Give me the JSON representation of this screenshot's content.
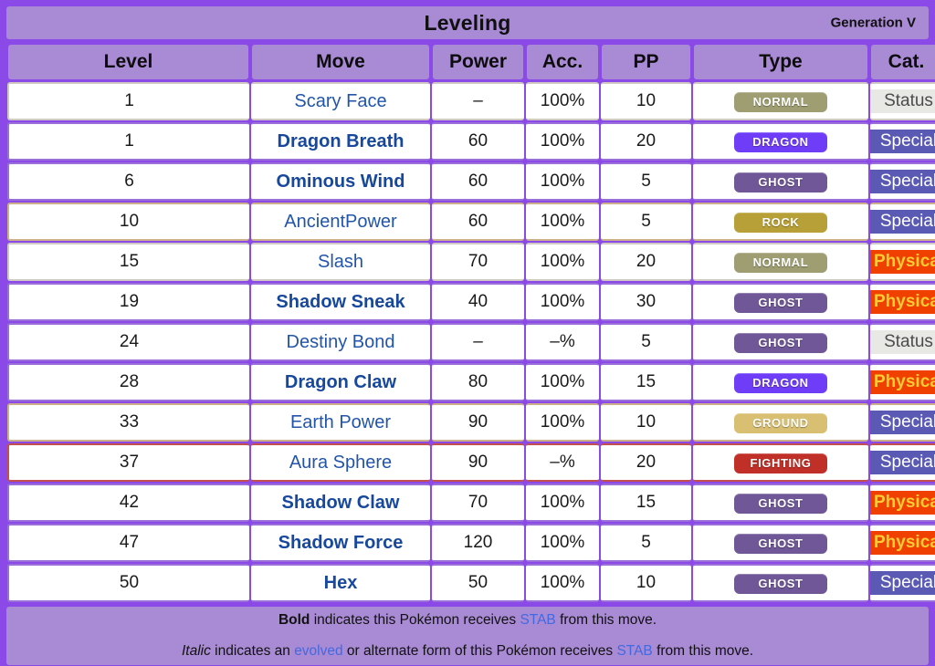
{
  "header": {
    "title": "Leveling",
    "generation": "Generation V"
  },
  "columns": [
    {
      "key": "level",
      "label": "Level"
    },
    {
      "key": "move",
      "label": "Move"
    },
    {
      "key": "power",
      "label": "Power"
    },
    {
      "key": "acc",
      "label": "Acc."
    },
    {
      "key": "pp",
      "label": "PP"
    },
    {
      "key": "type",
      "label": "Type"
    },
    {
      "key": "cat",
      "label": "Cat."
    }
  ],
  "type_colors": {
    "NORMAL": "#9e9e72",
    "DRAGON": "#6f3df7",
    "GHOST": "#705898",
    "ROCK": "#b8a038",
    "GROUND": "#d8bf72",
    "FIGHTING": "#c03028"
  },
  "category_colors": {
    "Status": "#e8e8e4",
    "Special": "#5a5ab5",
    "Physical": "#f04000"
  },
  "accent_colors": {
    "frame": "#8b4ae8",
    "panel": "#a98ad4",
    "move_link": "#2255aa",
    "stab_link": "#4169e1"
  },
  "rows": [
    {
      "level": "1",
      "move": "Scary Face",
      "stab": false,
      "power": "–",
      "acc": "100%",
      "pp": "10",
      "type": "NORMAL",
      "cat": "Status",
      "border": "grey"
    },
    {
      "level": "1",
      "move": "Dragon Breath",
      "stab": true,
      "power": "60",
      "acc": "100%",
      "pp": "20",
      "type": "DRAGON",
      "cat": "Special",
      "border": "purple"
    },
    {
      "level": "6",
      "move": "Ominous Wind",
      "stab": true,
      "power": "60",
      "acc": "100%",
      "pp": "5",
      "type": "GHOST",
      "cat": "Special",
      "border": "purple"
    },
    {
      "level": "10",
      "move": "AncientPower",
      "stab": false,
      "power": "60",
      "acc": "100%",
      "pp": "5",
      "type": "ROCK",
      "cat": "Special",
      "border": "tan"
    },
    {
      "level": "15",
      "move": "Slash",
      "stab": false,
      "power": "70",
      "acc": "100%",
      "pp": "20",
      "type": "NORMAL",
      "cat": "Physical",
      "border": "grey"
    },
    {
      "level": "19",
      "move": "Shadow Sneak",
      "stab": true,
      "power": "40",
      "acc": "100%",
      "pp": "30",
      "type": "GHOST",
      "cat": "Physical",
      "border": "purple"
    },
    {
      "level": "24",
      "move": "Destiny Bond",
      "stab": false,
      "power": "–",
      "acc": "–%",
      "pp": "5",
      "type": "GHOST",
      "cat": "Status",
      "border": "purple"
    },
    {
      "level": "28",
      "move": "Dragon Claw",
      "stab": true,
      "power": "80",
      "acc": "100%",
      "pp": "15",
      "type": "DRAGON",
      "cat": "Physical",
      "border": "purple"
    },
    {
      "level": "33",
      "move": "Earth Power",
      "stab": false,
      "power": "90",
      "acc": "100%",
      "pp": "10",
      "type": "GROUND",
      "cat": "Special",
      "border": "tan"
    },
    {
      "level": "37",
      "move": "Aura Sphere",
      "stab": false,
      "power": "90",
      "acc": "–%",
      "pp": "20",
      "type": "FIGHTING",
      "cat": "Special",
      "border": "red"
    },
    {
      "level": "42",
      "move": "Shadow Claw",
      "stab": true,
      "power": "70",
      "acc": "100%",
      "pp": "15",
      "type": "GHOST",
      "cat": "Physical",
      "border": "purple"
    },
    {
      "level": "47",
      "move": "Shadow Force",
      "stab": true,
      "power": "120",
      "acc": "100%",
      "pp": "5",
      "type": "GHOST",
      "cat": "Physical",
      "border": "purple"
    },
    {
      "level": "50",
      "move": "Hex",
      "stab": true,
      "power": "50",
      "acc": "100%",
      "pp": "10",
      "type": "GHOST",
      "cat": "Special",
      "border": "purple"
    }
  ],
  "footer": {
    "line1": {
      "bold": "Bold",
      "mid1": " indicates this Pokémon receives ",
      "link": "STAB",
      "mid2": " from this move."
    },
    "line2": {
      "italic": "Italic",
      "mid1": " indicates an ",
      "link1": "evolved",
      "mid2": " or alternate form of this Pokémon receives ",
      "link2": "STAB",
      "mid3": " from this move."
    }
  }
}
